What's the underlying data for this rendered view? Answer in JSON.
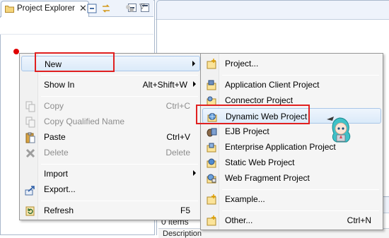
{
  "explorer": {
    "tab_title": "Project Explorer",
    "tab_close": "✕",
    "view_menu_arrow": "▽"
  },
  "problems": {
    "items_count": "0 items",
    "column_description": "Description"
  },
  "context_menu": {
    "items": [
      {
        "label": "New",
        "accelerator": "",
        "submenu": true,
        "enabled": true,
        "highlighted": true,
        "icon": "none"
      },
      {
        "label": "Show In",
        "accelerator": "Alt+Shift+W",
        "submenu": true,
        "enabled": true,
        "icon": "none"
      },
      {
        "label": "Copy",
        "accelerator": "Ctrl+C",
        "enabled": false,
        "icon": "copy-icon"
      },
      {
        "label": "Copy Qualified Name",
        "accelerator": "",
        "enabled": false,
        "icon": "copy-qualified-icon"
      },
      {
        "label": "Paste",
        "accelerator": "Ctrl+V",
        "enabled": true,
        "icon": "paste-icon"
      },
      {
        "label": "Delete",
        "accelerator": "Delete",
        "enabled": false,
        "icon": "delete-icon"
      },
      {
        "label": "Import",
        "accelerator": "",
        "submenu": true,
        "enabled": true,
        "icon": "none"
      },
      {
        "label": "Export...",
        "accelerator": "",
        "enabled": true,
        "icon": "export-icon"
      },
      {
        "label": "Refresh",
        "accelerator": "F5",
        "enabled": true,
        "icon": "refresh-icon"
      }
    ]
  },
  "new_submenu": {
    "items": [
      {
        "label": "Project...",
        "accelerator": "",
        "icon": "new-project-icon"
      },
      {
        "label": "Application Client Project",
        "accelerator": "",
        "icon": "app-client-project-icon"
      },
      {
        "label": "Connector Project",
        "accelerator": "",
        "icon": "connector-project-icon"
      },
      {
        "label": "Dynamic Web Project",
        "accelerator": "",
        "icon": "dynamic-web-project-icon",
        "highlighted": true
      },
      {
        "label": "EJB Project",
        "accelerator": "",
        "icon": "ejb-project-icon"
      },
      {
        "label": "Enterprise Application Project",
        "accelerator": "",
        "icon": "enterprise-app-project-icon"
      },
      {
        "label": "Static Web Project",
        "accelerator": "",
        "icon": "static-web-project-icon"
      },
      {
        "label": "Web Fragment Project",
        "accelerator": "",
        "icon": "web-fragment-project-icon"
      },
      {
        "label": "Example...",
        "accelerator": "",
        "icon": "example-icon"
      },
      {
        "label": "Other...",
        "accelerator": "Ctrl+N",
        "icon": "other-wizard-icon"
      }
    ]
  },
  "colors": {
    "highlight_outline": "#e02020",
    "menu_background": "#f5f5f5",
    "disabled_text": "#8d8d8d",
    "view_border": "#a9b8cc"
  }
}
